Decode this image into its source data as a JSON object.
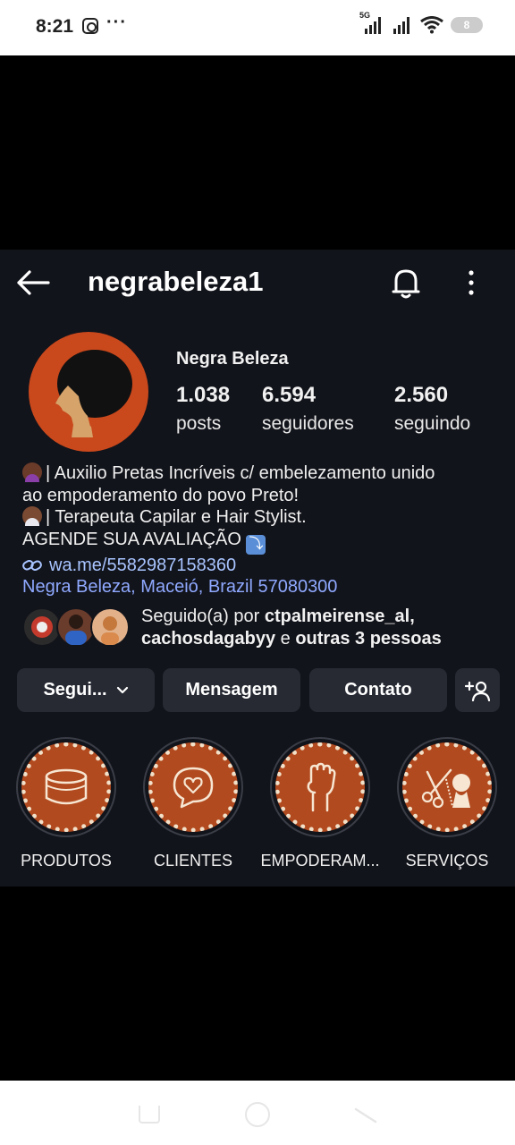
{
  "status_bar": {
    "time": "8:21",
    "notification_dots": "···",
    "network": "5G",
    "battery": "8"
  },
  "header": {
    "username": "negrabeleza1"
  },
  "profile": {
    "display_name": "Negra Beleza",
    "stats": [
      {
        "value": "1.038",
        "label": "posts"
      },
      {
        "value": "6.594",
        "label": "seguidores"
      },
      {
        "value": "2.560",
        "label": "seguindo"
      }
    ],
    "bio": {
      "line1": "| Auxilio  Pretas Incríveis c/ embelezamento unido",
      "line2": "ao empoderamento do povo Preto!",
      "line3": "| Terapeuta Capilar e Hair Stylist.",
      "line4": "AGENDE SUA AVALIAÇÃO",
      "link": "wa.me/5582987158360",
      "location": "Negra Beleza, Maceió, Brazil 57080300"
    },
    "followed_by": {
      "prefix": "Seguido(a) por",
      "user1": "ctpalmeirense_al,",
      "user2": "cachosdagabyy",
      "connector": "e",
      "others": "outras 3 pessoas"
    }
  },
  "buttons": {
    "following": "Segui...",
    "message": "Mensagem",
    "contact": "Contato"
  },
  "highlights": [
    {
      "label": "PRODUTOS",
      "icon": "cream-jar-icon"
    },
    {
      "label": "CLIENTES",
      "icon": "heart-chat-icon"
    },
    {
      "label": "EMPODERAM...",
      "icon": "raised-fist-icon"
    },
    {
      "label": "SERVIÇOS",
      "icon": "scissors-comb-icon"
    }
  ],
  "colors": {
    "background": "#12141b",
    "button": "#272a33",
    "link": "#a8c4ff",
    "avatar": "#c9481c",
    "highlight": "#b24a1f"
  }
}
